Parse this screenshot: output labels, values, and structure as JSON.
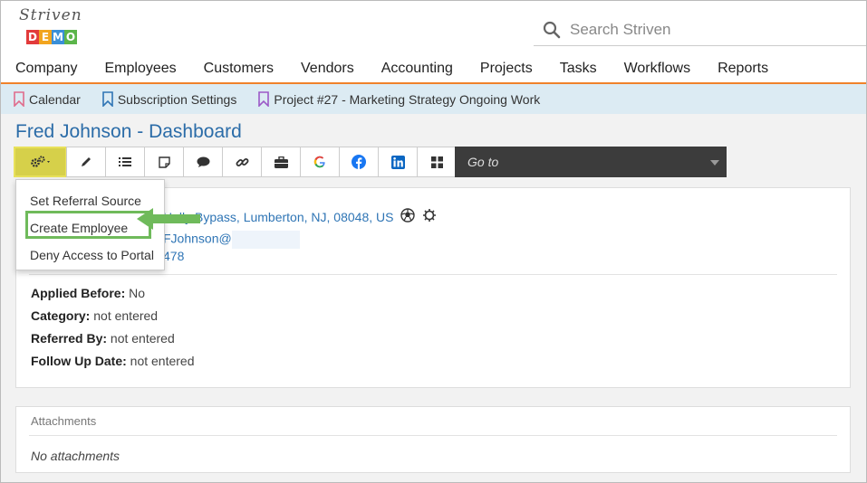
{
  "logo": {
    "script_text": "Striven",
    "demo_letters": [
      "D",
      "E",
      "M",
      "O"
    ],
    "demo_colors": [
      "#e23b3b",
      "#f2a51f",
      "#3a8fd8",
      "#5bb54a"
    ]
  },
  "search": {
    "placeholder": "Search Striven",
    "value": ""
  },
  "main_nav": [
    "Company",
    "Employees",
    "Customers",
    "Vendors",
    "Accounting",
    "Projects",
    "Tasks",
    "Workflows",
    "Reports"
  ],
  "bookmarks": [
    {
      "label": "Calendar",
      "color": "#e06c8c"
    },
    {
      "label": "Subscription Settings",
      "color": "#2f75b5"
    },
    {
      "label": "Project #27 - Marketing Strategy Ongoing Work",
      "color": "#9b59c7"
    }
  ],
  "page": {
    "title": "Fred Johnson - Dashboard"
  },
  "toolbar": {
    "buttons": [
      "gear-menu",
      "edit",
      "list",
      "note",
      "comment",
      "link",
      "briefcase",
      "google",
      "facebook",
      "linkedin",
      "grid"
    ],
    "goto_label": "Go to"
  },
  "dropdown": {
    "items": [
      "Set Referral Source",
      "Create Employee",
      "Deny Access to Portal"
    ],
    "highlighted_item": "Create Employee"
  },
  "contact": {
    "address": "Holly Bypass, Lumberton, NJ, 08048, US",
    "email_prefix": "FJohnson@",
    "phone_fragment": "478"
  },
  "fields": [
    {
      "label": "Applied Before:",
      "value": "No"
    },
    {
      "label": "Category:",
      "value": "not entered"
    },
    {
      "label": "Referred By:",
      "value": "not entered"
    },
    {
      "label": "Follow Up Date:",
      "value": "not entered"
    }
  ],
  "attachments": {
    "title": "Attachments",
    "empty_text": "No attachments"
  },
  "colors": {
    "accent_orange": "#f0822a",
    "title_blue": "#2b6ca8",
    "link_blue": "#2f75b5",
    "highlight_yellow": "#d6d04a",
    "annotation_green": "#6fba5b"
  }
}
